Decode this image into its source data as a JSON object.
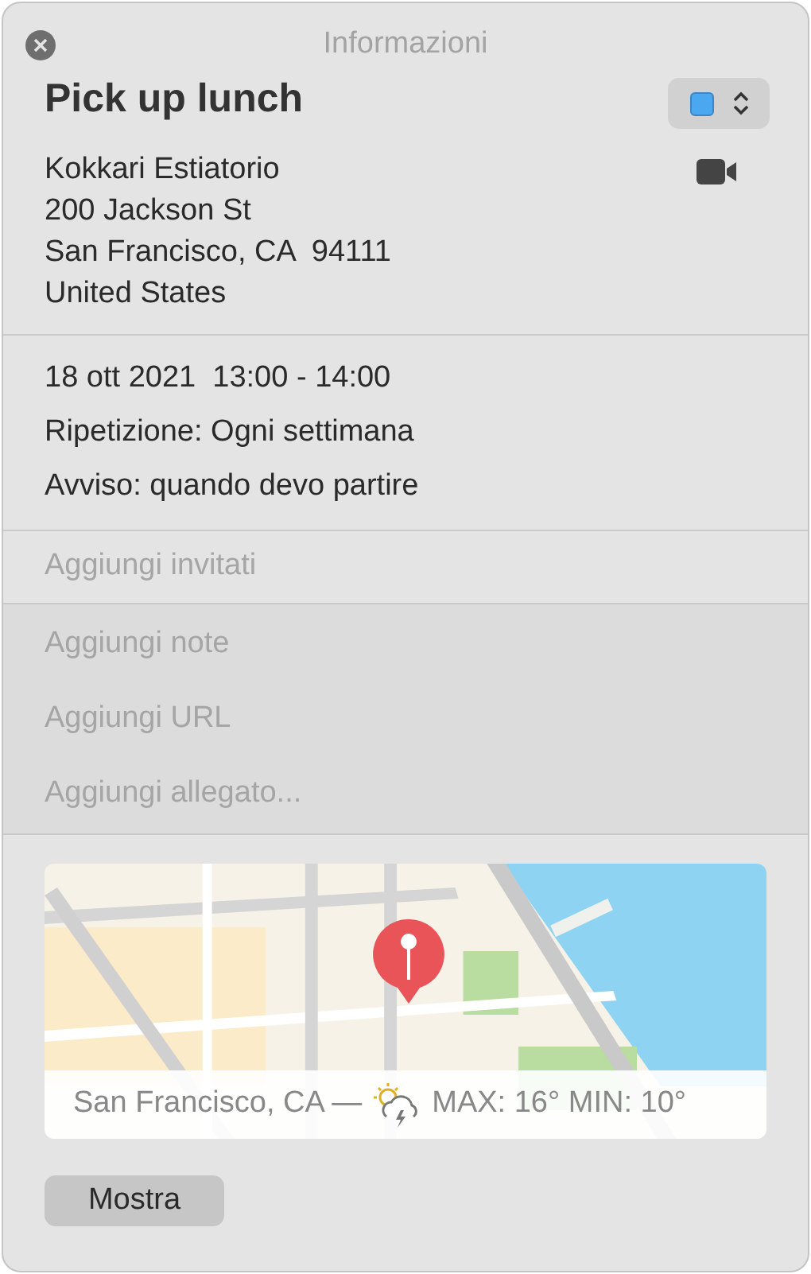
{
  "window": {
    "title": "Informazioni"
  },
  "event": {
    "title": "Pick up lunch",
    "color": "#4aa8f0"
  },
  "location": {
    "lines": [
      "Kokkari Estiatorio",
      "200 Jackson St",
      "San Francisco, CA  94111",
      "United States"
    ]
  },
  "schedule": {
    "date_time": "18 ott 2021  13:00 - 14:00",
    "repeat": "Ripetizione: Ogni settimana",
    "alert": "Avviso: quando devo partire"
  },
  "invitees": {
    "placeholder": "Aggiungi invitati"
  },
  "extras": [
    {
      "placeholder": "Aggiungi note"
    },
    {
      "placeholder": "Aggiungi URL"
    },
    {
      "placeholder": "Aggiungi allegato..."
    }
  ],
  "map": {
    "weather": {
      "place": "San Francisco, CA —",
      "temps": "MAX: 16° MIN: 10°"
    }
  },
  "buttons": [
    {
      "label": "Mostra"
    }
  ]
}
